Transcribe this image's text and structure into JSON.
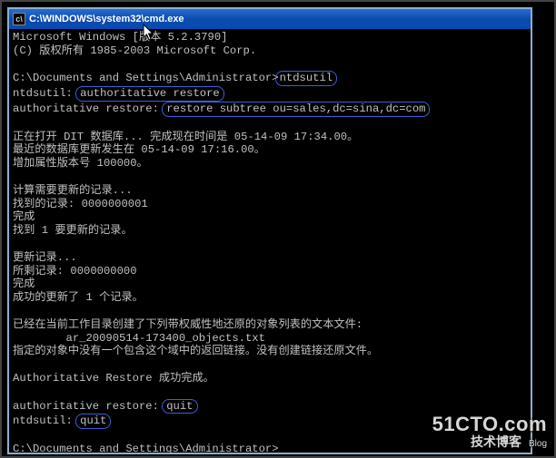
{
  "window": {
    "title": "C:\\WINDOWS\\system32\\cmd.exe",
    "icon_label": "cmd-icon"
  },
  "console": {
    "header1": "Microsoft Windows [版本 5.2.3790]",
    "header2": "(C) 版权所有 1985-2003 Microsoft Corp.",
    "prompt1_path": "C:\\Documents and Settings\\Administrator>",
    "prompt1_cmd": "ntdsutil",
    "line_ntdsutil_prefix": "ntdsutil:",
    "line_ntdsutil_cmd": "authoritative restore",
    "line_authres_prefix": "authoritative restore:",
    "line_authres_cmd": "restore subtree ou=sales,dc=sina,dc=com",
    "open_dit": "正在打开 DIT 数据库... 完成现在时间是 05-14-09 17:34.00。",
    "recent_update": "最近的数据库更新发生在 05-14-09 17:16.00。",
    "attr_version": "增加属性版本号 100000。",
    "calc_records": "计算需要更新的记录...",
    "found_records": "找到的记录: 0000000001",
    "done1": "完成",
    "found_one": "找到 1 要更新的记录。",
    "update_records": "更新记录...",
    "remain_records": "所剩记录: 0000000000",
    "done2": "完成",
    "success_update": "成功的更新了 1 个记录。",
    "created_file_intro": "已经在当前工作目录创建了下列带权威性地还原的对象列表的文本文件:",
    "created_file_name": "        ar_20090514-173400_objects.txt",
    "no_backlinks": "指定的对象中没有一个包含这个域中的返回链接。没有创建链接还原文件。",
    "auth_restore_done": "Authoritative Restore 成功完成。",
    "quit1_prefix": "authoritative restore:",
    "quit1_cmd": "quit",
    "quit2_prefix": "ntdsutil:",
    "quit2_cmd": "quit",
    "prompt2": "C:\\Documents and Settings\\Administrator>"
  },
  "watermark": {
    "line1": "51CTO.com",
    "line2_main": "技术博客",
    "line2_sub": "Blog"
  }
}
